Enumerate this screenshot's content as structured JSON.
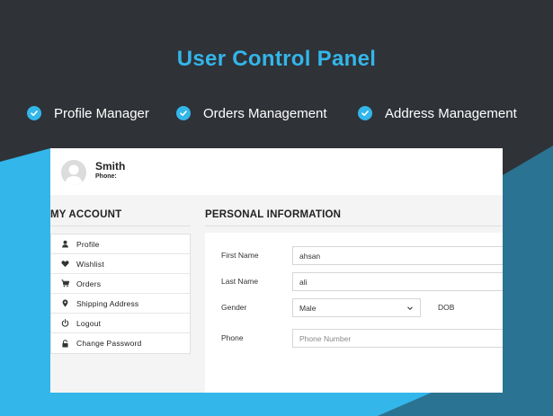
{
  "hero": {
    "title": "User Control Panel",
    "features": [
      "Profile Manager",
      "Orders Management",
      "Address Management"
    ]
  },
  "user": {
    "name": "Smith",
    "phone_label": "Phone:"
  },
  "account": {
    "heading": "MY ACCOUNT",
    "menu": [
      {
        "label": "Profile",
        "icon": "user-icon"
      },
      {
        "label": "Wishlist",
        "icon": "heart-icon"
      },
      {
        "label": "Orders",
        "icon": "cart-icon"
      },
      {
        "label": "Shipping Address",
        "icon": "map-pin-icon"
      },
      {
        "label": "Logout",
        "icon": "power-icon"
      },
      {
        "label": "Change Password",
        "icon": "lock-icon"
      }
    ]
  },
  "personal": {
    "heading": "PERSONAL INFORMATION",
    "first_name_label": "First Name",
    "first_name_value": "ahsan",
    "last_name_label": "Last Name",
    "last_name_value": "ali",
    "gender_label": "Gender",
    "gender_value": "Male",
    "dob_label": "DOB",
    "phone_label": "Phone",
    "phone_placeholder": "Phone Number"
  },
  "colors": {
    "accent": "#33b6ea",
    "dark_bg": "#2f3237",
    "teal_bg": "#2b7392"
  }
}
